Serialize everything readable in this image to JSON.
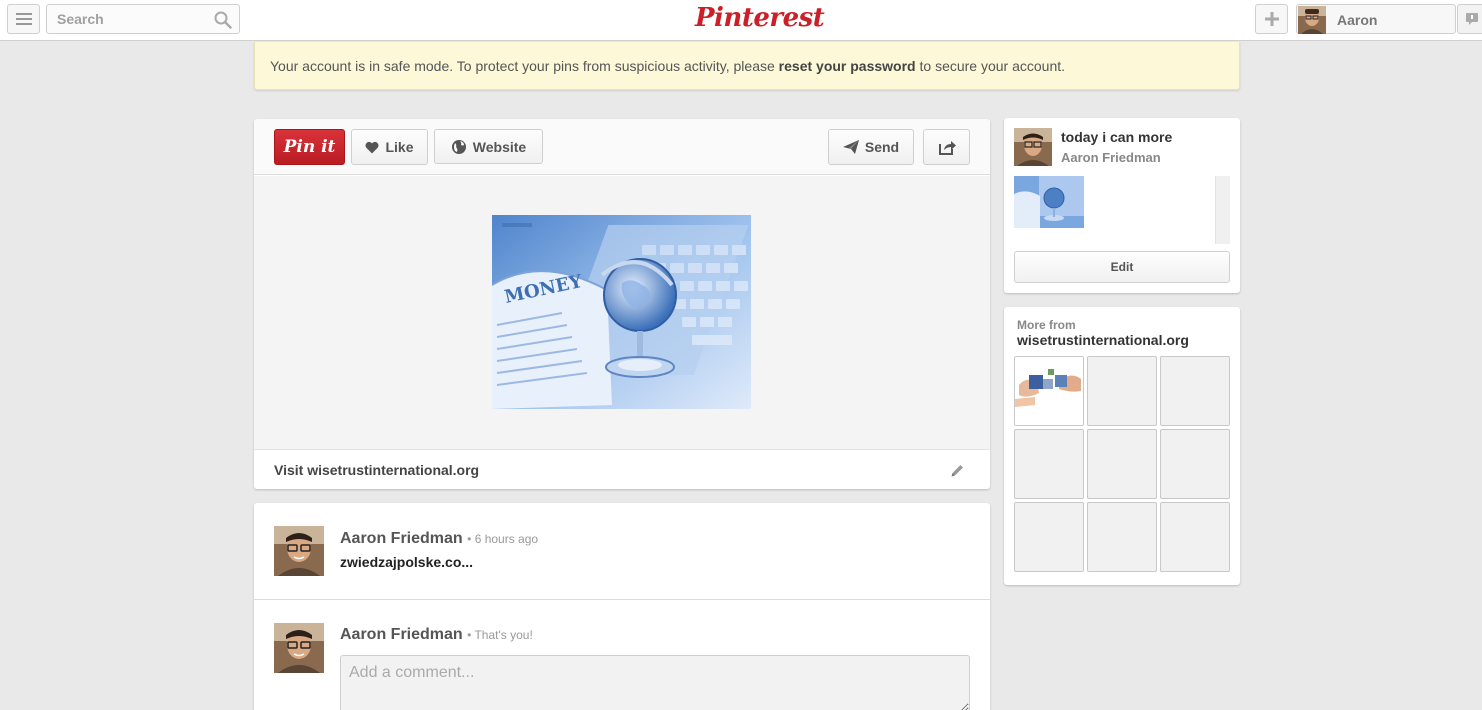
{
  "header": {
    "search_placeholder": "Search",
    "logo_text": "Pinterest",
    "user_name": "Aaron",
    "brand_color": "#cb2027"
  },
  "banner": {
    "text_before": "Your account is in safe mode. To protect your pins from suspicious activity, please ",
    "link_text": "reset your password",
    "text_after": " to secure your account.",
    "background": "#fcf8d8"
  },
  "pin": {
    "pinit_label": "Pin it",
    "like_label": "Like",
    "website_label": "Website",
    "send_label": "Send",
    "visit_text": "Visit wisetrustinternational.org",
    "image_text": "MONEY"
  },
  "comments": [
    {
      "name": "Aaron Friedman",
      "meta": "6 hours ago",
      "text": "zwiedzajpolske.co..."
    },
    {
      "name": "Aaron Friedman",
      "meta": "That's you!"
    }
  ],
  "comment_form": {
    "placeholder": "Add a comment..."
  },
  "board": {
    "title": "today i can more",
    "owner": "Aaron Friedman",
    "edit_label": "Edit"
  },
  "more_from": {
    "label": "More from",
    "domain": "wisetrustinternational.org"
  }
}
